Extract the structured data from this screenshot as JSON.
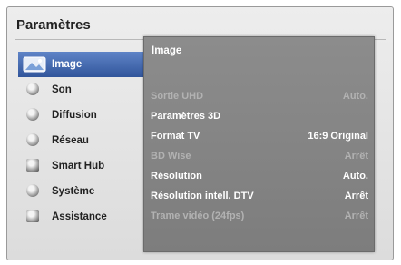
{
  "window": {
    "title": "Paramètres"
  },
  "menu": {
    "items": [
      {
        "label": "Image",
        "icon": "picture-icon",
        "selected": true
      },
      {
        "label": "Son",
        "icon": "speaker-icon"
      },
      {
        "label": "Diffusion",
        "icon": "broadcast-icon"
      },
      {
        "label": "Réseau",
        "icon": "globe-icon"
      },
      {
        "label": "Smart Hub",
        "icon": "smart-hub-icon"
      },
      {
        "label": "Système",
        "icon": "gear-icon"
      },
      {
        "label": "Assistance",
        "icon": "support-icon"
      }
    ]
  },
  "panel": {
    "title": "Image",
    "rows": [
      {
        "name": "Sortie UHD",
        "value": "Auto.",
        "state": "dim"
      },
      {
        "name": "Paramètres 3D",
        "value": "",
        "state": "on"
      },
      {
        "name": "Format TV",
        "value": "16:9 Original",
        "state": "on"
      },
      {
        "name": "BD Wise",
        "value": "Arrêt",
        "state": "dim"
      },
      {
        "name": "Résolution",
        "value": "Auto.",
        "state": "on"
      },
      {
        "name": "Résolution intell. DTV",
        "value": "Arrêt",
        "state": "on"
      },
      {
        "name": "Trame vidéo (24fps)",
        "value": "Arrêt",
        "state": "dim"
      }
    ]
  },
  "colors": {
    "selected_accent": "#3f66ae",
    "panel_background": "#858585",
    "enabled_text": "#ffffff",
    "disabled_text": "#b2b2b2"
  }
}
